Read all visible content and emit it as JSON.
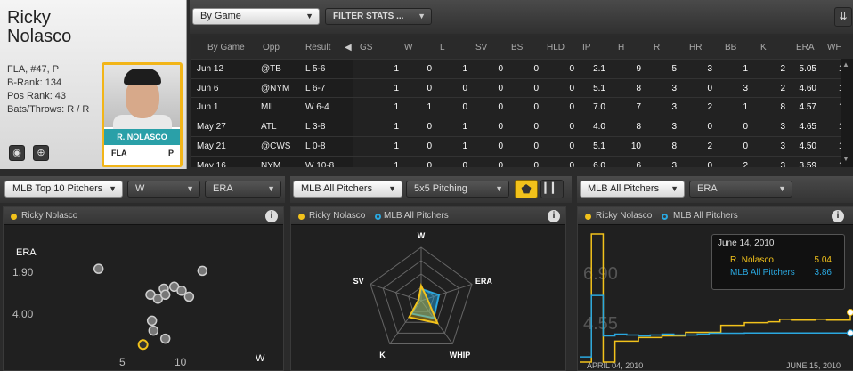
{
  "player": {
    "first": "Ricky",
    "last": "Nolasco",
    "info": [
      "FLA, #47, P",
      "B-Rank: 134",
      "Pos Rank: 43",
      "Bats/Throws: R / R"
    ],
    "card_name": "R. NOLASCO",
    "card_team": "FLA",
    "card_pos": "P"
  },
  "stats": {
    "view": "By Game",
    "filter": "FILTER STATS ...",
    "left_headers": [
      "By Game",
      "Opp",
      "Result"
    ],
    "headers": [
      "GS",
      "W",
      "L",
      "SV",
      "BS",
      "HLD",
      "IP",
      "H",
      "R",
      "HR",
      "BB",
      "K",
      "ERA",
      "WH"
    ],
    "rows": [
      {
        "date": "Jun 12",
        "opp": "@TB",
        "result": "L 5-6",
        "vals": [
          "1",
          "0",
          "1",
          "0",
          "0",
          "0",
          "2.1",
          "9",
          "5",
          "3",
          "1",
          "2",
          "5.05",
          "1."
        ]
      },
      {
        "date": "Jun 6",
        "opp": "@NYM",
        "result": "L 6-7",
        "vals": [
          "1",
          "0",
          "0",
          "0",
          "0",
          "0",
          "5.1",
          "8",
          "3",
          "0",
          "3",
          "2",
          "4.60",
          "1."
        ]
      },
      {
        "date": "Jun 1",
        "opp": "MIL",
        "result": "W 6-4",
        "vals": [
          "1",
          "1",
          "0",
          "0",
          "0",
          "0",
          "7.0",
          "7",
          "3",
          "2",
          "1",
          "8",
          "4.57",
          "1."
        ]
      },
      {
        "date": "May 27",
        "opp": "ATL",
        "result": "L 3-8",
        "vals": [
          "1",
          "0",
          "1",
          "0",
          "0",
          "0",
          "4.0",
          "8",
          "3",
          "0",
          "0",
          "3",
          "4.65",
          "1."
        ]
      },
      {
        "date": "May 21",
        "opp": "@CWS",
        "result": "L 0-8",
        "vals": [
          "1",
          "0",
          "1",
          "0",
          "0",
          "0",
          "5.1",
          "10",
          "8",
          "2",
          "0",
          "3",
          "4.50",
          "1."
        ]
      },
      {
        "date": "May 16",
        "opp": "NYM",
        "result": "W 10-8",
        "vals": [
          "1",
          "0",
          "0",
          "0",
          "0",
          "0",
          "6.0",
          "6",
          "3",
          "0",
          "2",
          "3",
          "3.59",
          "1."
        ]
      }
    ]
  },
  "scatter_panel": {
    "dd1": "MLB Top 10 Pitchers",
    "dd2": "W",
    "dd3": "ERA",
    "legend": "Ricky Nolasco",
    "colors": {
      "player": "#f2c21b",
      "others": "#cfcfcf"
    }
  },
  "radar_panel": {
    "dd1": "MLB All Pitchers",
    "dd2": "5x5 Pitching",
    "legend_player": "Ricky Nolasco",
    "legend_mlb": "MLB All Pitchers",
    "colors": {
      "player": "#f2c21b",
      "mlb": "#2aa8e0"
    }
  },
  "line_panel": {
    "dd1": "MLB All Pitchers",
    "dd2": "ERA",
    "legend_player": "Ricky Nolasco",
    "legend_mlb": "MLB All Pitchers",
    "tooltip": {
      "date": "June 14, 2010",
      "player_label": "R. Nolasco",
      "player_val": "5.04",
      "mlb_label": "MLB All Pitchers",
      "mlb_val": "3.86"
    }
  },
  "chart_data": [
    {
      "type": "scatter",
      "title": "",
      "ylabel": "ERA",
      "xlabel": "W",
      "x_ticks": [
        "5",
        "10"
      ],
      "y_ticks": [
        "1.90",
        "4.00"
      ],
      "series": [
        {
          "name": "Ricky Nolasco",
          "points": [
            {
              "x": 4.8,
              "y": 5.5
            }
          ]
        },
        {
          "points": [
            {
              "x": 1.8,
              "y": 1.7
            },
            {
              "x": 8.8,
              "y": 1.8
            },
            {
              "x": 6.2,
              "y": 2.7
            },
            {
              "x": 6.9,
              "y": 2.6
            },
            {
              "x": 7.4,
              "y": 2.8
            },
            {
              "x": 5.3,
              "y": 3.0
            },
            {
              "x": 5.8,
              "y": 3.2
            },
            {
              "x": 6.3,
              "y": 3.0
            },
            {
              "x": 7.9,
              "y": 3.1
            },
            {
              "x": 5.4,
              "y": 4.3
            },
            {
              "x": 5.5,
              "y": 4.8
            },
            {
              "x": 6.3,
              "y": 5.2
            }
          ]
        }
      ]
    },
    {
      "type": "radar",
      "axes": [
        "W",
        "ERA",
        "WHIP",
        "K",
        "SV"
      ],
      "series": [
        {
          "name": "Ricky Nolasco",
          "values": [
            0.28,
            0.12,
            0.52,
            0.38,
            0.05
          ]
        },
        {
          "name": "MLB All Pitchers",
          "values": [
            0.22,
            0.35,
            0.4,
            0.3,
            0.05
          ]
        }
      ]
    },
    {
      "type": "line",
      "y_ticks": [
        "6.90",
        "4.55"
      ],
      "x_ticks": [
        "APRIL 04, 2010",
        "JUNE 15, 2010"
      ],
      "series": [
        {
          "name": "R. Nolasco",
          "values": [
            2.2,
            9.5,
            2.2,
            3.4,
            3.4,
            3.6,
            3.6,
            3.7,
            3.7,
            3.9,
            3.9,
            3.9,
            4.3,
            4.3,
            4.45,
            4.45,
            4.5,
            4.65,
            4.6,
            4.6,
            4.65,
            4.6,
            4.6,
            5.04
          ]
        },
        {
          "name": "MLB All Pitchers",
          "values": [
            2.5,
            6.0,
            3.7,
            3.8,
            3.75,
            3.7,
            3.75,
            3.8,
            3.75,
            3.75,
            3.8,
            3.85,
            3.85,
            3.85,
            3.86,
            3.86,
            3.86,
            3.86,
            3.86,
            3.86,
            3.86,
            3.86,
            3.86,
            3.86
          ]
        }
      ]
    }
  ]
}
